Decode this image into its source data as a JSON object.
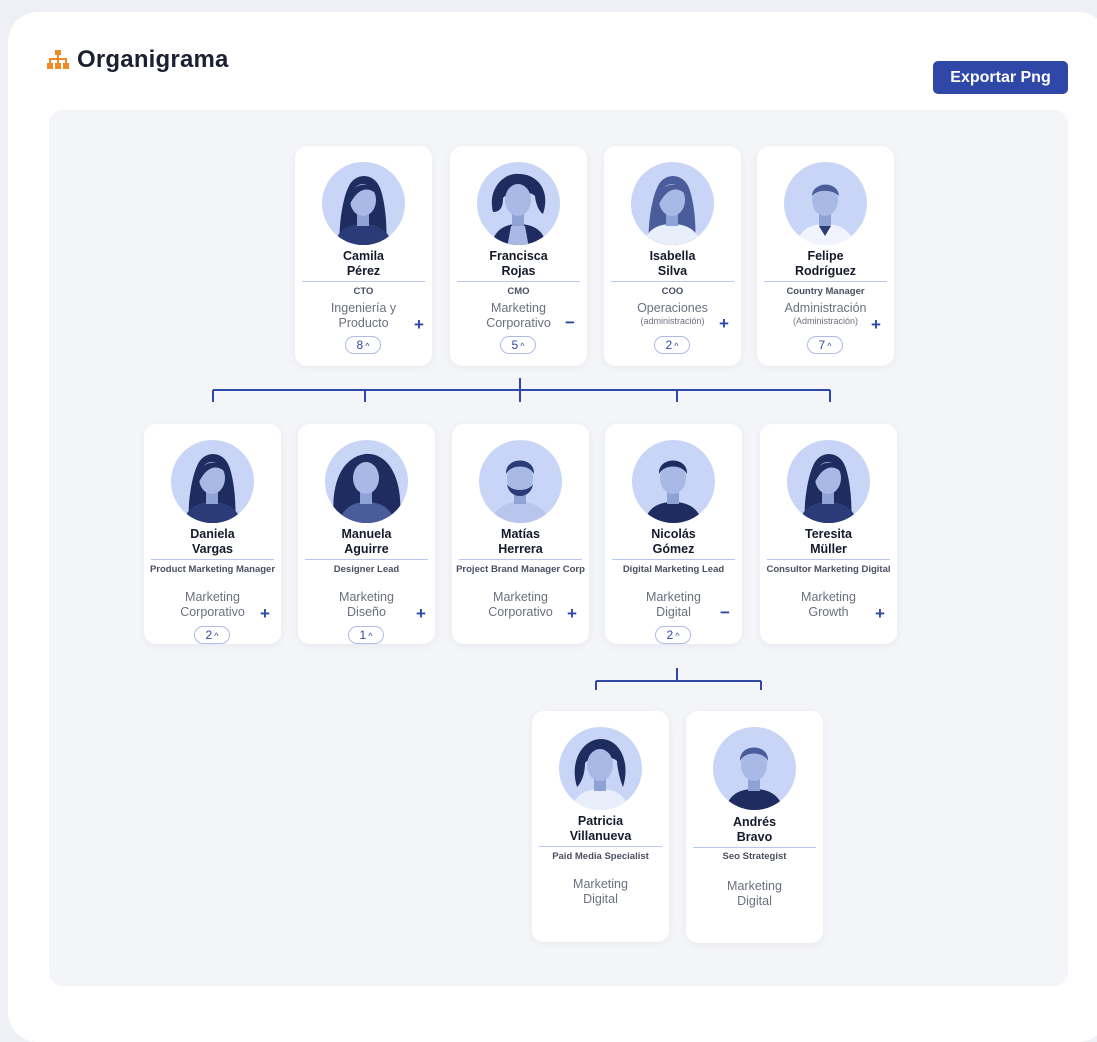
{
  "header": {
    "title": "Organigrama",
    "title_icon": "org-chart-icon",
    "export_label": "Exportar Png"
  },
  "colors": {
    "accent": "#2f48a8",
    "icon": "#ef8a24",
    "avatar_bg": "#c9d5f6",
    "connector": "#2f48a8"
  },
  "nodes": [
    {
      "first": "Camila",
      "last": "Pérez",
      "role": "CTO",
      "dept": "Ingeniería y",
      "dept2": "Producto",
      "sub": "",
      "toggle": "+",
      "count": "8",
      "photo": "woman-long-dark"
    },
    {
      "first": "Francisca",
      "last": "Rojas",
      "role": "CMO",
      "dept": "Marketing",
      "dept2": "Corporativo",
      "sub": "",
      "toggle": "−",
      "count": "5",
      "photo": "woman-curly-short"
    },
    {
      "first": "Isabella",
      "last": "Silva",
      "role": "COO",
      "dept": "Operaciones",
      "dept2": "",
      "sub": "(administración)",
      "toggle": "+",
      "count": "2",
      "photo": "woman-long-light"
    },
    {
      "first": "Felipe",
      "last": "Rodríguez",
      "role": "Country Manager",
      "dept": "Administración",
      "dept2": "",
      "sub": "(Administración)",
      "toggle": "+",
      "count": "7",
      "photo": "man-gray-hair"
    },
    {
      "first": "Daniela",
      "last": "Vargas",
      "role": "Product Marketing Manager",
      "dept": "Marketing",
      "dept2": "Corporativo",
      "sub": "",
      "toggle": "+",
      "count": "2",
      "photo": "woman-long-dark"
    },
    {
      "first": "Manuela",
      "last": "Aguirre",
      "role": "Designer Lead",
      "dept": "Marketing",
      "dept2": "Diseño",
      "sub": "",
      "toggle": "+",
      "count": "1",
      "photo": "woman-curly-long"
    },
    {
      "first": "Matías",
      "last": "Herrera",
      "role": "Project Brand Manager Corp",
      "dept": "Marketing",
      "dept2": "Corporativo",
      "sub": "",
      "toggle": "+",
      "count": "",
      "photo": "man-beard"
    },
    {
      "first": "Nicolás",
      "last": "Gómez",
      "role": "Digital Marketing Lead",
      "dept": "Marketing",
      "dept2": "Digital",
      "sub": "",
      "toggle": "−",
      "count": "2",
      "photo": "man-short-hair"
    },
    {
      "first": "Teresita",
      "last": "Müller",
      "role": "Consultor Marketing Digital",
      "dept": "Marketing",
      "dept2": "Growth",
      "sub": "",
      "toggle": "+",
      "count": "",
      "photo": "woman-long-dark"
    },
    {
      "first": "Patricia",
      "last": "Villanueva",
      "role": "Paid Media Specialist",
      "dept": "Marketing",
      "dept2": "Digital",
      "sub": "",
      "toggle": "",
      "count": "",
      "photo": "woman-short-hair"
    },
    {
      "first": "Andrés",
      "last": "Bravo",
      "role": "Seo Strategist",
      "dept": "Marketing",
      "dept2": "Digital",
      "sub": "",
      "toggle": "",
      "count": "",
      "photo": "man-smiling"
    }
  ]
}
